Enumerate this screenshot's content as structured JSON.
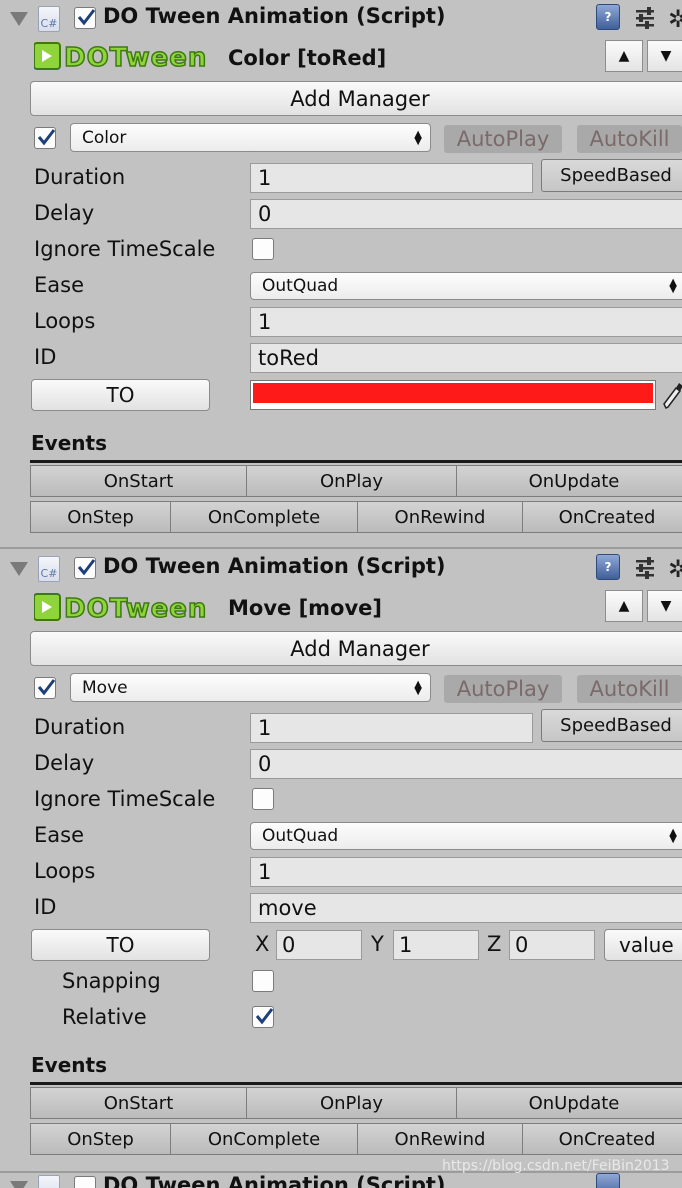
{
  "components": [
    {
      "title": "DO Tween Animation (Script)",
      "subtitle": "Color [toRed]",
      "add_manager": "Add Manager",
      "animation_type": "Color",
      "autoplay": "AutoPlay",
      "autokill": "AutoKill",
      "speed_based": "SpeedBased",
      "labels": {
        "duration": "Duration",
        "delay": "Delay",
        "ignore_timescale": "Ignore TimeScale",
        "ease": "Ease",
        "loops": "Loops",
        "id": "ID"
      },
      "values": {
        "duration": "1",
        "delay": "0",
        "ease": "OutQuad",
        "loops": "1",
        "id": "toRed"
      },
      "to_button": "TO",
      "to_color": "#ff1a1a",
      "events_title": "Events",
      "events_row1": [
        "OnStart",
        "OnPlay",
        "OnUpdate"
      ],
      "events_row2": [
        "OnStep",
        "OnComplete",
        "OnRewind",
        "OnCreated"
      ]
    },
    {
      "title": "DO Tween Animation (Script)",
      "subtitle": "Move [move]",
      "add_manager": "Add Manager",
      "animation_type": "Move",
      "autoplay": "AutoPlay",
      "autokill": "AutoKill",
      "speed_based": "SpeedBased",
      "labels": {
        "duration": "Duration",
        "delay": "Delay",
        "ignore_timescale": "Ignore TimeScale",
        "ease": "Ease",
        "loops": "Loops",
        "id": "ID",
        "snapping": "Snapping",
        "relative": "Relative"
      },
      "values": {
        "duration": "1",
        "delay": "0",
        "ease": "OutQuad",
        "loops": "1",
        "id": "move"
      },
      "to_button": "TO",
      "vector": {
        "x_label": "X",
        "x": "0",
        "y_label": "Y",
        "y": "1",
        "z_label": "Z",
        "z": "0"
      },
      "value_button": "value",
      "relative_checked": true,
      "events_title": "Events",
      "events_row1": [
        "OnStart",
        "OnPlay",
        "OnUpdate"
      ],
      "events_row2": [
        "OnStep",
        "OnComplete",
        "OnRewind",
        "OnCreated"
      ]
    },
    {
      "title": "DO Tween Animation (Script)"
    }
  ],
  "logo_text": "DOTween",
  "icons": {
    "foldout": "foldout-arrow-icon",
    "script": "cs-script-icon",
    "help": "help-book-icon",
    "presets": "presets-sliders-icon",
    "settings": "gear-icon",
    "picker": "eyedropper-icon"
  },
  "watermark": "https://blog.csdn.net/FeiBin2013"
}
